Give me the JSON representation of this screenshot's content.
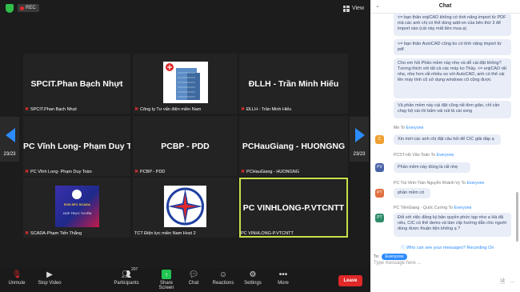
{
  "meeting": {
    "rec_label": "REC",
    "view_label": "View",
    "prev_page": "23/23",
    "next_page": "23/23",
    "tiles": [
      {
        "center": "SPCIT.Phan Bạch Nhựt",
        "label": "SPCIT.Phan Bạch Nhựt"
      },
      {
        "center": "",
        "label": "Công ty Tư vấn điện miền Nam"
      },
      {
        "center": "ĐLLH - Trần Minh Hiếu",
        "label": "ĐLLH - Trần Minh Hiếu"
      },
      {
        "center": "PC Vĩnh Long- Phạm Duy T...",
        "label": "PC Vĩnh Long- Phạm Duy Toàn"
      },
      {
        "center": "PCBP - PDD",
        "label": "PCBP - PDD"
      },
      {
        "center": "PCHauGiang - HUONGNG",
        "label": "PCHauGiang - HUONGNG"
      },
      {
        "center": "",
        "label": "SCADA-Phạm Tiến Thắng"
      },
      {
        "center": "",
        "label": "TCT Điện lực miền Nam Host 2"
      },
      {
        "center": "PC VINHLONG-P.VTCNTT",
        "label": "PC VINHLONG-P.VTCNTT"
      }
    ],
    "scada_sign": {
      "line1": "EVN SPC SCADA",
      "line2": "HỌP TRỰC TUYẾN"
    }
  },
  "toolbar": {
    "unmute": "Unmute",
    "stop_video": "Stop Video",
    "participants": "Participants",
    "participants_count": "207",
    "share_screen": "Share Screen",
    "chat": "Chat",
    "reactions": "Reactions",
    "settings": "Settings",
    "more": "More",
    "leave": "Leave"
  },
  "chat": {
    "title": "Chat",
    "b1": "<= bạn thân enjiCAD không có tính năng import từ PDF mà các anh chị có thể dùng add-on của bên thứ 3 để import vào (cái này mất tiền mua ạ)",
    "b2": "<= bạn thân AutoCAD cũng ko có tính năng import từ pdf",
    "b3": "Cho em hỏi Phần mềm này nhẹ và dễ cài đặt không? Tương thích với tất cả các máy ko Thầy. <= enjiCAD rất nhẹ, nhẹ hơn rất nhiều so với AutoCAD, anh có thể cài lên máy tính cũ sử dụng windows cũ cũng được",
    "b4": "Và phần mềm này cài đặt cũng rất đơn giản, chỉ cần chạy bộ cài rồi bấm vài nút là cài xong",
    "m1_from": "Me",
    "m1_to": "Everyone",
    "m1_text": "Xin mời các anh chị đặt câu hỏi để CIC giải đáp ạ",
    "m1_avatar": "C",
    "m2_from": "PCST-Hồ Văn Toàn",
    "m2_to": "Everyone",
    "m2_text": "Phần mềm này đúng là rất nhẹ",
    "m2_avatar": "PV",
    "m3_from": "PC Trà Vinh-Trần Nguyễn Khánh Vy",
    "m3_to": "Everyone",
    "m3_text": "phần mềm có",
    "m3_avatar": "PT",
    "m4_from": "PC TiềnGiang - Quốc Cường",
    "m4_to": "Everyone",
    "m4_text": "Đối với việc đăng ký bản quyền phức tạp như a Hà đã nêu, CIC có thể demo và làm clip hướng dẫn cho người dùng được thuận tiện không ạ ?",
    "m4_avatar": "PT",
    "to_word": "To",
    "hint": "Who can see your messages? Recording On",
    "to_label": "To:",
    "to_value": "Everyone",
    "placeholder": "Type message here ..."
  },
  "colors": {
    "accent": "#2d8cff",
    "leave": "#e02828",
    "active_border": "#c8e04a"
  }
}
